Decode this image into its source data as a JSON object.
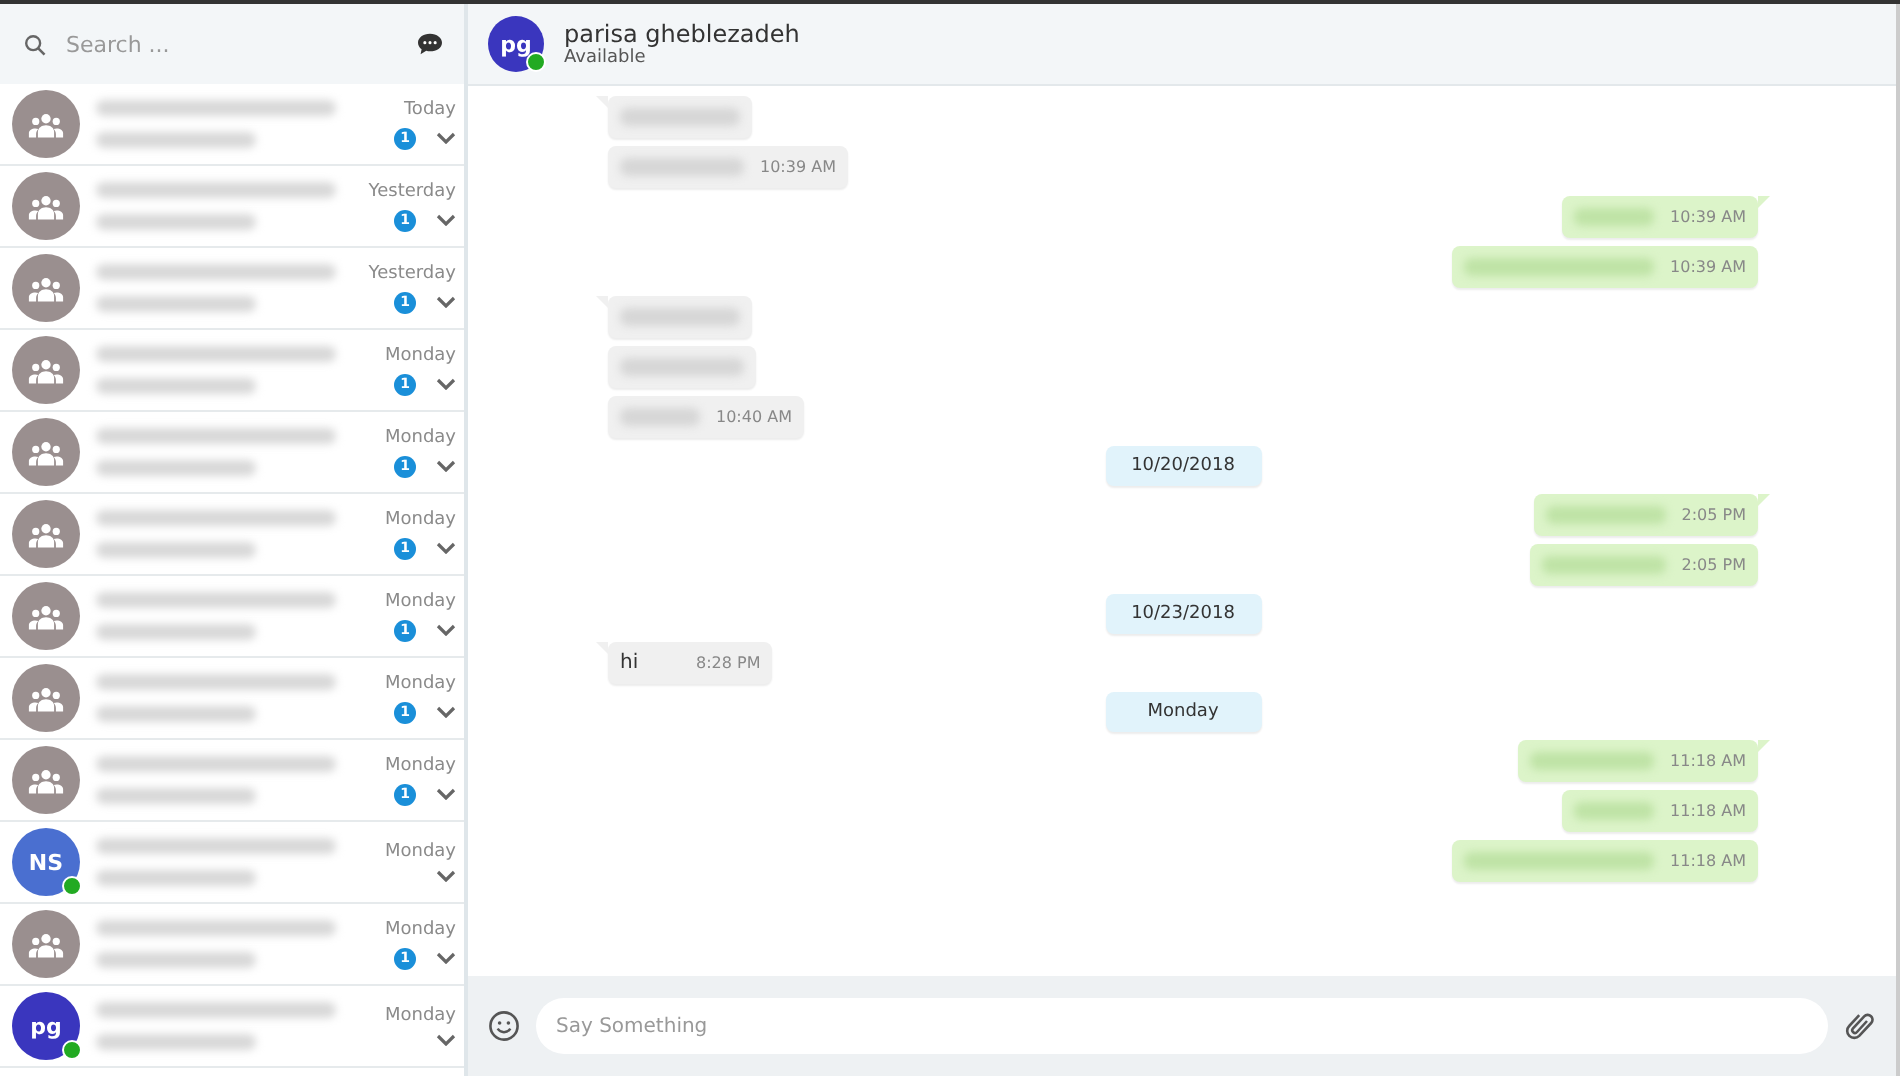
{
  "sidebar": {
    "search": {
      "placeholder": "Search ..."
    },
    "conversations": [
      {
        "kind": "group",
        "time": "Today",
        "unread": "1",
        "online": false
      },
      {
        "kind": "group",
        "time": "Yesterday",
        "unread": "1",
        "online": false
      },
      {
        "kind": "group",
        "time": "Yesterday",
        "unread": "1",
        "online": false
      },
      {
        "kind": "group",
        "time": "Monday",
        "unread": "1",
        "online": false
      },
      {
        "kind": "group",
        "time": "Monday",
        "unread": "1",
        "online": false
      },
      {
        "kind": "group",
        "time": "Monday",
        "unread": "1",
        "online": false
      },
      {
        "kind": "group",
        "time": "Monday",
        "unread": "1",
        "online": false
      },
      {
        "kind": "group",
        "time": "Monday",
        "unread": "1",
        "online": false
      },
      {
        "kind": "group",
        "time": "Monday",
        "unread": "1",
        "online": false
      },
      {
        "kind": "initials",
        "initials": "NS",
        "color": "#4a6fd0",
        "time": "Monday",
        "online": true
      },
      {
        "kind": "group",
        "time": "Monday",
        "unread": "1",
        "online": false
      },
      {
        "kind": "initials",
        "initials": "pg",
        "color": "#3a36be",
        "time": "Monday",
        "online": true
      }
    ]
  },
  "chat": {
    "contact": {
      "initials": "pg",
      "name": "parisa gheblezadeh",
      "status": "Available",
      "online": true
    },
    "items": [
      {
        "kind": "message",
        "outgoing": false
      },
      {
        "kind": "message",
        "outgoing": false,
        "time": "10:39 AM"
      },
      {
        "kind": "message",
        "outgoing": true,
        "time": "10:39 AM"
      },
      {
        "kind": "message",
        "outgoing": true,
        "time": "10:39 AM"
      },
      {
        "kind": "message",
        "outgoing": false
      },
      {
        "kind": "message",
        "outgoing": false
      },
      {
        "kind": "message",
        "outgoing": false,
        "time": "10:40 AM"
      },
      {
        "kind": "date",
        "text": "10/20/2018"
      },
      {
        "kind": "message",
        "outgoing": true,
        "time": "2:05 PM"
      },
      {
        "kind": "message",
        "outgoing": true,
        "time": "2:05 PM"
      },
      {
        "kind": "date",
        "text": "10/23/2018"
      },
      {
        "kind": "message",
        "outgoing": false,
        "text": "hi",
        "time": "8:28 PM"
      },
      {
        "kind": "date",
        "text": "Monday"
      },
      {
        "kind": "message",
        "outgoing": true,
        "time": "11:18 AM"
      },
      {
        "kind": "message",
        "outgoing": true,
        "time": "11:18 AM"
      },
      {
        "kind": "message",
        "outgoing": true,
        "time": "11:18 AM"
      }
    ],
    "composer": {
      "placeholder": "Say Something"
    }
  }
}
